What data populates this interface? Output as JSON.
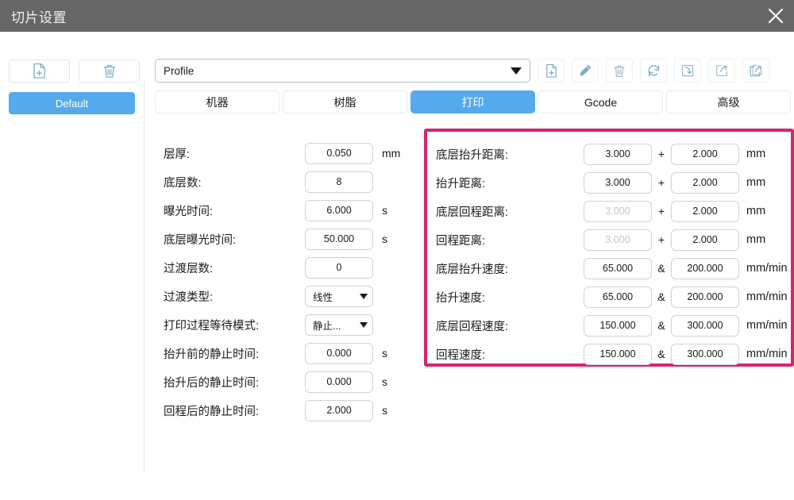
{
  "window": {
    "title": "切片设置",
    "close_icon": "close-icon"
  },
  "sidebar": {
    "buttons": [
      {
        "name": "add-profile-button",
        "icon": "file-plus-icon"
      },
      {
        "name": "delete-profile-button",
        "icon": "trash-icon"
      }
    ],
    "profiles": [
      {
        "label": "Default",
        "selected": true
      }
    ]
  },
  "toolbar": {
    "profile_select": {
      "value": "Profile",
      "caret_icon": "chevron-down-icon"
    },
    "buttons": [
      {
        "name": "new-button",
        "icon": "file-plus-icon"
      },
      {
        "name": "edit-button",
        "icon": "pencil-icon"
      },
      {
        "name": "delete-button",
        "icon": "trash-icon"
      },
      {
        "name": "refresh-button",
        "icon": "refresh-icon"
      },
      {
        "name": "import-button",
        "icon": "import-arrow-icon"
      },
      {
        "name": "export-button",
        "icon": "export-arrow-icon"
      },
      {
        "name": "export-all-button",
        "icon": "export-copy-icon"
      }
    ]
  },
  "tabs": [
    {
      "label": "机器",
      "active": false
    },
    {
      "label": "树脂",
      "active": false
    },
    {
      "label": "打印",
      "active": true
    },
    {
      "label": "Gcode",
      "active": false
    },
    {
      "label": "高级",
      "active": false
    }
  ],
  "print_settings_left": [
    {
      "label": "层厚:",
      "type": "input",
      "value": "0.050",
      "unit": "mm",
      "disabled": false
    },
    {
      "label": "底层数:",
      "type": "input",
      "value": "8",
      "unit": "",
      "disabled": false
    },
    {
      "label": "曝光时间:",
      "type": "input",
      "value": "6.000",
      "unit": "s",
      "disabled": false
    },
    {
      "label": "底层曝光时间:",
      "type": "input",
      "value": "50.000",
      "unit": "s",
      "disabled": false
    },
    {
      "label": "过渡层数:",
      "type": "input",
      "value": "0",
      "unit": "",
      "disabled": false
    },
    {
      "label": "过渡类型:",
      "type": "select",
      "value": "线性",
      "unit": "",
      "disabled": false
    },
    {
      "label": "打印过程等待模式:",
      "type": "select",
      "value": "静止...",
      "unit": "",
      "disabled": false
    },
    {
      "label": "抬升前的静止时间:",
      "type": "input",
      "value": "0.000",
      "unit": "s",
      "disabled": false
    },
    {
      "label": "抬升后的静止时间:",
      "type": "input",
      "value": "0.000",
      "unit": "s",
      "disabled": false
    },
    {
      "label": "回程后的静止时间:",
      "type": "input",
      "value": "2.000",
      "unit": "s",
      "disabled": false
    }
  ],
  "print_settings_right": {
    "highlight_color": "#d6246e",
    "rows": [
      {
        "label": "底层抬升距离:",
        "value1": "3.000",
        "op": "+",
        "value2": "2.000",
        "unit": "mm",
        "v1_disabled": false
      },
      {
        "label": "抬升距离:",
        "value1": "3.000",
        "op": "+",
        "value2": "2.000",
        "unit": "mm",
        "v1_disabled": false
      },
      {
        "label": "底层回程距离:",
        "value1": "3.000",
        "op": "+",
        "value2": "2.000",
        "unit": "mm",
        "v1_disabled": true
      },
      {
        "label": "回程距离:",
        "value1": "3.000",
        "op": "+",
        "value2": "2.000",
        "unit": "mm",
        "v1_disabled": true
      },
      {
        "label": "底层抬升速度:",
        "value1": "65.000",
        "op": "&",
        "value2": "200.000",
        "unit": "mm/min",
        "v1_disabled": false
      },
      {
        "label": "抬升速度:",
        "value1": "65.000",
        "op": "&",
        "value2": "200.000",
        "unit": "mm/min",
        "v1_disabled": false
      },
      {
        "label": "底层回程速度:",
        "value1": "150.000",
        "op": "&",
        "value2": "300.000",
        "unit": "mm/min",
        "v1_disabled": false
      },
      {
        "label": "回程速度:",
        "value1": "150.000",
        "op": "&",
        "value2": "300.000",
        "unit": "mm/min",
        "v1_disabled": false
      }
    ]
  },
  "colors": {
    "titlebar": "#666666",
    "accent_blue": "#55aaee",
    "highlight_pink": "#d6246e",
    "icon_blue": "#7badcb"
  }
}
